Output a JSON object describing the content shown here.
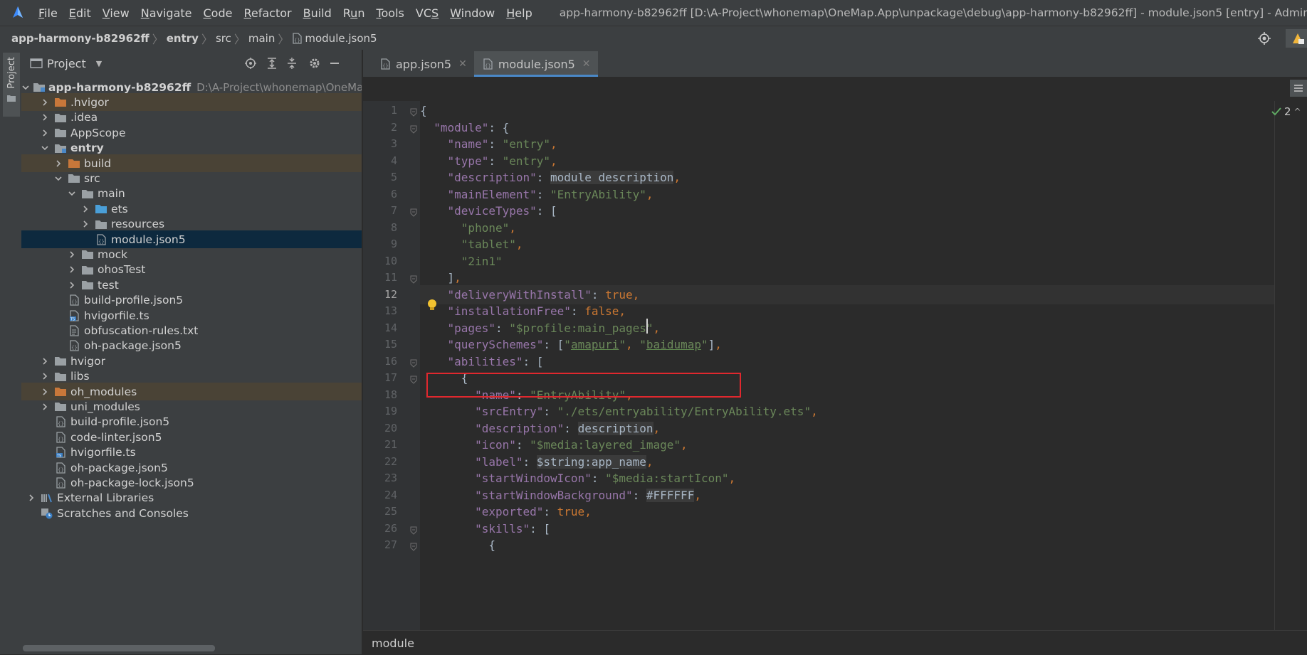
{
  "menubar": {
    "items": [
      {
        "label": "File",
        "mnemonic": "F"
      },
      {
        "label": "Edit",
        "mnemonic": "E"
      },
      {
        "label": "View",
        "mnemonic": "V"
      },
      {
        "label": "Navigate",
        "mnemonic": "N"
      },
      {
        "label": "Code",
        "mnemonic": "C"
      },
      {
        "label": "Refactor",
        "mnemonic": "R"
      },
      {
        "label": "Build",
        "mnemonic": "B"
      },
      {
        "label": "Run",
        "mnemonic": "u"
      },
      {
        "label": "Tools",
        "mnemonic": "T"
      },
      {
        "label": "VCS",
        "mnemonic": "S"
      },
      {
        "label": "Window",
        "mnemonic": "W"
      },
      {
        "label": "Help",
        "mnemonic": "H"
      }
    ],
    "title": "app-harmony-b82962ff [D:\\A-Project\\whonemap\\OneMap.App\\unpackage\\debug\\app-harmony-b82962ff] - module.json5 [entry] - Administrator"
  },
  "breadcrumb": [
    "app-harmony-b82962ff",
    "entry",
    "src",
    "main",
    "module.json5"
  ],
  "left_stripe": {
    "label": "Project"
  },
  "project_panel": {
    "title": "Project",
    "tree": [
      {
        "label": "app-harmony-b82962ff",
        "path": "D:\\A-Project\\whonemap\\OneMa",
        "depth": 0,
        "arrow": "open",
        "icon": "module-folder",
        "bold": true
      },
      {
        "label": ".hvigor",
        "depth": 1,
        "arrow": "closed",
        "icon": "folder-orange",
        "style": "excluded"
      },
      {
        "label": ".idea",
        "depth": 1,
        "arrow": "closed",
        "icon": "folder"
      },
      {
        "label": "AppScope",
        "depth": 1,
        "arrow": "closed",
        "icon": "folder"
      },
      {
        "label": "entry",
        "depth": 1,
        "arrow": "open",
        "icon": "module-folder",
        "bold": true
      },
      {
        "label": "build",
        "depth": 2,
        "arrow": "closed",
        "icon": "folder-orange",
        "style": "excluded"
      },
      {
        "label": "src",
        "depth": 2,
        "arrow": "open",
        "icon": "folder"
      },
      {
        "label": "main",
        "depth": 3,
        "arrow": "open",
        "icon": "folder"
      },
      {
        "label": "ets",
        "depth": 4,
        "arrow": "closed",
        "icon": "folder-blue"
      },
      {
        "label": "resources",
        "depth": 4,
        "arrow": "closed",
        "icon": "folder"
      },
      {
        "label": "module.json5",
        "depth": 4,
        "arrow": "none",
        "icon": "json-file",
        "style": "selected"
      },
      {
        "label": "mock",
        "depth": 3,
        "arrow": "closed",
        "icon": "folder"
      },
      {
        "label": "ohosTest",
        "depth": 3,
        "arrow": "closed",
        "icon": "folder"
      },
      {
        "label": "test",
        "depth": 3,
        "arrow": "closed",
        "icon": "folder"
      },
      {
        "label": "build-profile.json5",
        "depth": 2,
        "arrow": "none",
        "icon": "json-file"
      },
      {
        "label": "hvigorfile.ts",
        "depth": 2,
        "arrow": "none",
        "icon": "ts-file"
      },
      {
        "label": "obfuscation-rules.txt",
        "depth": 2,
        "arrow": "none",
        "icon": "text-file"
      },
      {
        "label": "oh-package.json5",
        "depth": 2,
        "arrow": "none",
        "icon": "json-file"
      },
      {
        "label": "hvigor",
        "depth": 1,
        "arrow": "closed",
        "icon": "folder"
      },
      {
        "label": "libs",
        "depth": 1,
        "arrow": "closed",
        "icon": "folder"
      },
      {
        "label": "oh_modules",
        "depth": 1,
        "arrow": "closed",
        "icon": "folder-orange",
        "style": "excluded"
      },
      {
        "label": "uni_modules",
        "depth": 1,
        "arrow": "closed",
        "icon": "folder"
      },
      {
        "label": "build-profile.json5",
        "depth": 1,
        "arrow": "none",
        "icon": "json-file"
      },
      {
        "label": "code-linter.json5",
        "depth": 1,
        "arrow": "none",
        "icon": "json-file"
      },
      {
        "label": "hvigorfile.ts",
        "depth": 1,
        "arrow": "none",
        "icon": "ts-file"
      },
      {
        "label": "oh-package.json5",
        "depth": 1,
        "arrow": "none",
        "icon": "json-file"
      },
      {
        "label": "oh-package-lock.json5",
        "depth": 1,
        "arrow": "none",
        "icon": "json-file"
      },
      {
        "label": "External Libraries",
        "depth": 0,
        "arrow": "closed",
        "icon": "library"
      },
      {
        "label": "Scratches and Consoles",
        "depth": 0,
        "arrow": "none",
        "icon": "scratch"
      }
    ]
  },
  "editor": {
    "tabs": [
      {
        "label": "app.json5",
        "active": false
      },
      {
        "label": "module.json5",
        "active": true
      }
    ],
    "current_line": 12,
    "lines": [
      {
        "n": 1,
        "fold": true,
        "tokens": [
          [
            "p",
            "{"
          ]
        ]
      },
      {
        "n": 2,
        "fold": true,
        "tokens": [
          [
            "p",
            "  "
          ],
          [
            "k",
            "\"module\""
          ],
          [
            "p",
            ": {"
          ]
        ]
      },
      {
        "n": 3,
        "tokens": [
          [
            "p",
            "    "
          ],
          [
            "k",
            "\"name\""
          ],
          [
            "p",
            ": "
          ],
          [
            "s",
            "\"entry\""
          ],
          [
            "b",
            ","
          ]
        ]
      },
      {
        "n": 4,
        "tokens": [
          [
            "p",
            "    "
          ],
          [
            "k",
            "\"type\""
          ],
          [
            "p",
            ": "
          ],
          [
            "s",
            "\"entry\""
          ],
          [
            "b",
            ","
          ]
        ]
      },
      {
        "n": 5,
        "tokens": [
          [
            "p",
            "    "
          ],
          [
            "k",
            "\"description\""
          ],
          [
            "p",
            ": "
          ],
          [
            "hl",
            "module description"
          ],
          [
            "b",
            ","
          ]
        ]
      },
      {
        "n": 6,
        "tokens": [
          [
            "p",
            "    "
          ],
          [
            "k",
            "\"mainElement\""
          ],
          [
            "p",
            ": "
          ],
          [
            "s",
            "\"EntryAbility\""
          ],
          [
            "b",
            ","
          ]
        ]
      },
      {
        "n": 7,
        "fold": true,
        "tokens": [
          [
            "p",
            "    "
          ],
          [
            "k",
            "\"deviceTypes\""
          ],
          [
            "p",
            ": ["
          ]
        ]
      },
      {
        "n": 8,
        "tokens": [
          [
            "p",
            "      "
          ],
          [
            "s",
            "\"phone\""
          ],
          [
            "b",
            ","
          ]
        ]
      },
      {
        "n": 9,
        "tokens": [
          [
            "p",
            "      "
          ],
          [
            "s",
            "\"tablet\""
          ],
          [
            "b",
            ","
          ]
        ]
      },
      {
        "n": 10,
        "tokens": [
          [
            "p",
            "      "
          ],
          [
            "s",
            "\"2in1\""
          ]
        ]
      },
      {
        "n": 11,
        "fold": true,
        "tokens": [
          [
            "p",
            "    ]"
          ],
          [
            "b",
            ","
          ]
        ]
      },
      {
        "n": 12,
        "tokens": [
          [
            "p",
            "    "
          ],
          [
            "k",
            "\"deliveryWithInstall\""
          ],
          [
            "p",
            ": "
          ],
          [
            "b",
            "true,"
          ]
        ]
      },
      {
        "n": 13,
        "tokens": [
          [
            "p",
            "    "
          ],
          [
            "k",
            "\"installationFree\""
          ],
          [
            "p",
            ": "
          ],
          [
            "b",
            "false,"
          ]
        ]
      },
      {
        "n": 14,
        "tokens": [
          [
            "p",
            "    "
          ],
          [
            "k",
            "\"pages\""
          ],
          [
            "p",
            ": "
          ],
          [
            "s",
            "\"$profile:main_pages\""
          ],
          [
            "b",
            ","
          ]
        ]
      },
      {
        "n": 15,
        "tokens": [
          [
            "p",
            "    "
          ],
          [
            "k",
            "\"querySchemes\""
          ],
          [
            "p",
            ": ["
          ],
          [
            "s",
            "\""
          ],
          [
            "su",
            "amapuri"
          ],
          [
            "s",
            "\""
          ],
          [
            "b",
            ", "
          ],
          [
            "s",
            "\""
          ],
          [
            "su",
            "baidumap"
          ],
          [
            "s",
            "\""
          ],
          [
            "p",
            "]"
          ],
          [
            "b",
            ","
          ]
        ]
      },
      {
        "n": 16,
        "fold": true,
        "tokens": [
          [
            "p",
            "    "
          ],
          [
            "k",
            "\"abilities\""
          ],
          [
            "p",
            ": ["
          ]
        ]
      },
      {
        "n": 17,
        "fold": true,
        "tokens": [
          [
            "p",
            "      {"
          ]
        ]
      },
      {
        "n": 18,
        "tokens": [
          [
            "p",
            "        "
          ],
          [
            "k",
            "\"name\""
          ],
          [
            "p",
            ": "
          ],
          [
            "s",
            "\"EntryAbility\""
          ],
          [
            "b",
            ","
          ]
        ]
      },
      {
        "n": 19,
        "tokens": [
          [
            "p",
            "        "
          ],
          [
            "k",
            "\"srcEntry\""
          ],
          [
            "p",
            ": "
          ],
          [
            "s",
            "\"./ets/entryability/EntryAbility.ets\""
          ],
          [
            "b",
            ","
          ]
        ]
      },
      {
        "n": 20,
        "tokens": [
          [
            "p",
            "        "
          ],
          [
            "k",
            "\"description\""
          ],
          [
            "p",
            ": "
          ],
          [
            "hl",
            "description"
          ],
          [
            "b",
            ","
          ]
        ]
      },
      {
        "n": 21,
        "tokens": [
          [
            "p",
            "        "
          ],
          [
            "k",
            "\"icon\""
          ],
          [
            "p",
            ": "
          ],
          [
            "s",
            "\"$media:layered_image\""
          ],
          [
            "b",
            ","
          ]
        ]
      },
      {
        "n": 22,
        "tokens": [
          [
            "p",
            "        "
          ],
          [
            "k",
            "\"label\""
          ],
          [
            "p",
            ": "
          ],
          [
            "hl",
            "$string:app_name"
          ],
          [
            "b",
            ","
          ]
        ]
      },
      {
        "n": 23,
        "tokens": [
          [
            "p",
            "        "
          ],
          [
            "k",
            "\"startWindowIcon\""
          ],
          [
            "p",
            ": "
          ],
          [
            "s",
            "\"$media:startIcon\""
          ],
          [
            "b",
            ","
          ]
        ]
      },
      {
        "n": 24,
        "tokens": [
          [
            "p",
            "        "
          ],
          [
            "k",
            "\"startWindowBackground\""
          ],
          [
            "p",
            ": "
          ],
          [
            "hl",
            "#FFFFFF"
          ],
          [
            "b",
            ","
          ]
        ]
      },
      {
        "n": 25,
        "tokens": [
          [
            "p",
            "        "
          ],
          [
            "k",
            "\"exported\""
          ],
          [
            "p",
            ": "
          ],
          [
            "b",
            "true,"
          ]
        ]
      },
      {
        "n": 26,
        "fold": true,
        "tokens": [
          [
            "p",
            "        "
          ],
          [
            "k",
            "\"skills\""
          ],
          [
            "p",
            ": ["
          ]
        ]
      },
      {
        "n": 27,
        "fold": true,
        "tokens": [
          [
            "p",
            "          {"
          ]
        ]
      }
    ],
    "inspection_count": "2",
    "status_breadcrumb": "module"
  },
  "colors": {
    "highlight_box": "#e0282e",
    "selection": "#0d293e",
    "accent": "#4a88c7"
  }
}
